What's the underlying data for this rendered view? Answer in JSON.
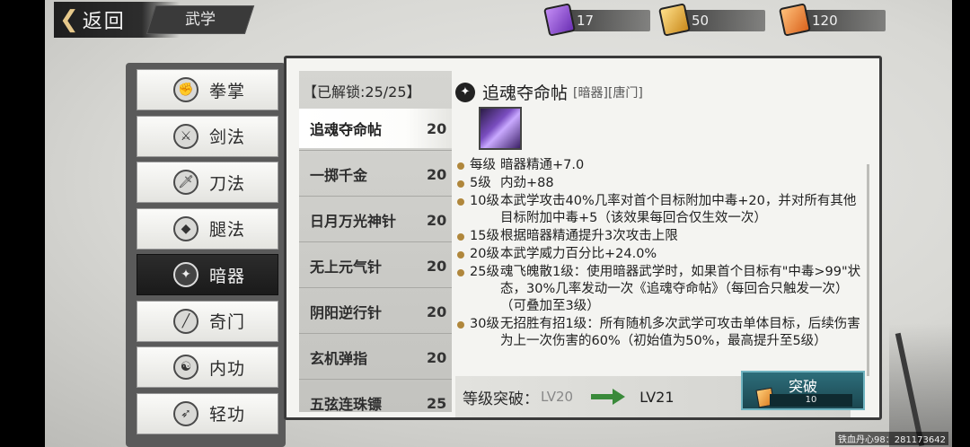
{
  "topbar": {
    "back_label": "返回",
    "title": "武学",
    "currencies": [
      {
        "icon": "purple-scroll-icon",
        "value": "17"
      },
      {
        "icon": "gold-scroll-icon",
        "value": "50"
      },
      {
        "icon": "orange-scroll-icon",
        "value": "120"
      }
    ]
  },
  "categories": [
    {
      "label": "拳掌",
      "icon": "fist-icon",
      "glyph": "✊"
    },
    {
      "label": "剑法",
      "icon": "sword-icon",
      "glyph": "⚔"
    },
    {
      "label": "刀法",
      "icon": "blade-icon",
      "glyph": "🗡"
    },
    {
      "label": "腿法",
      "icon": "kick-icon",
      "glyph": "◆"
    },
    {
      "label": "暗器",
      "icon": "shuriken-icon",
      "glyph": "✦"
    },
    {
      "label": "奇门",
      "icon": "staff-icon",
      "glyph": "╱"
    },
    {
      "label": "内功",
      "icon": "meditation-icon",
      "glyph": "☯"
    },
    {
      "label": "轻功",
      "icon": "shoe-icon",
      "glyph": "➶"
    }
  ],
  "skill_list": {
    "unlock_text": "【已解锁:25/25】",
    "items": [
      {
        "name": "追魂夺命帖",
        "level": "20"
      },
      {
        "name": "一掷千金",
        "level": "20"
      },
      {
        "name": "日月万光神针",
        "level": "20"
      },
      {
        "name": "无上元气针",
        "level": "20"
      },
      {
        "name": "阴阳逆行针",
        "level": "20"
      },
      {
        "name": "玄机弹指",
        "level": "20"
      },
      {
        "name": "五弦连珠镖",
        "level": "25"
      }
    ]
  },
  "detail": {
    "name": "追魂夺命帖",
    "tags": "[暗器][唐门]",
    "effects": [
      {
        "level": "每级",
        "text": "暗器精通+7.0"
      },
      {
        "level": "5级",
        "text": "内劲+88"
      },
      {
        "level": "10级",
        "text": "本武学攻击40%几率对首个目标附加中毒+20，并对所有其他目标附加中毒+5（该效果每回合仅生效一次）"
      },
      {
        "level": "15级",
        "text": "根据暗器精通提升3次攻击上限"
      },
      {
        "level": "20级",
        "text": "本武学威力百分比+24.0%"
      },
      {
        "level": "25级",
        "text": "魂飞魄散1级：使用暗器武学时，如果首个目标有\"中毒>99\"状态，30%几率发动一次《追魂夺命帖》（每回合只触发一次）（可叠加至3级）"
      },
      {
        "level": "30级",
        "text": "无招胜有招1级：所有随机多次武学可攻击单体目标，后续伤害为上一次伤害的60%（初始值为50%，最高提升至5级）"
      }
    ]
  },
  "upgrade": {
    "label": "等级突破：",
    "from": "LV20",
    "to": "LV21",
    "button_label": "突破",
    "cost": "10"
  },
  "watermark": "铁血丹心98：281173642"
}
